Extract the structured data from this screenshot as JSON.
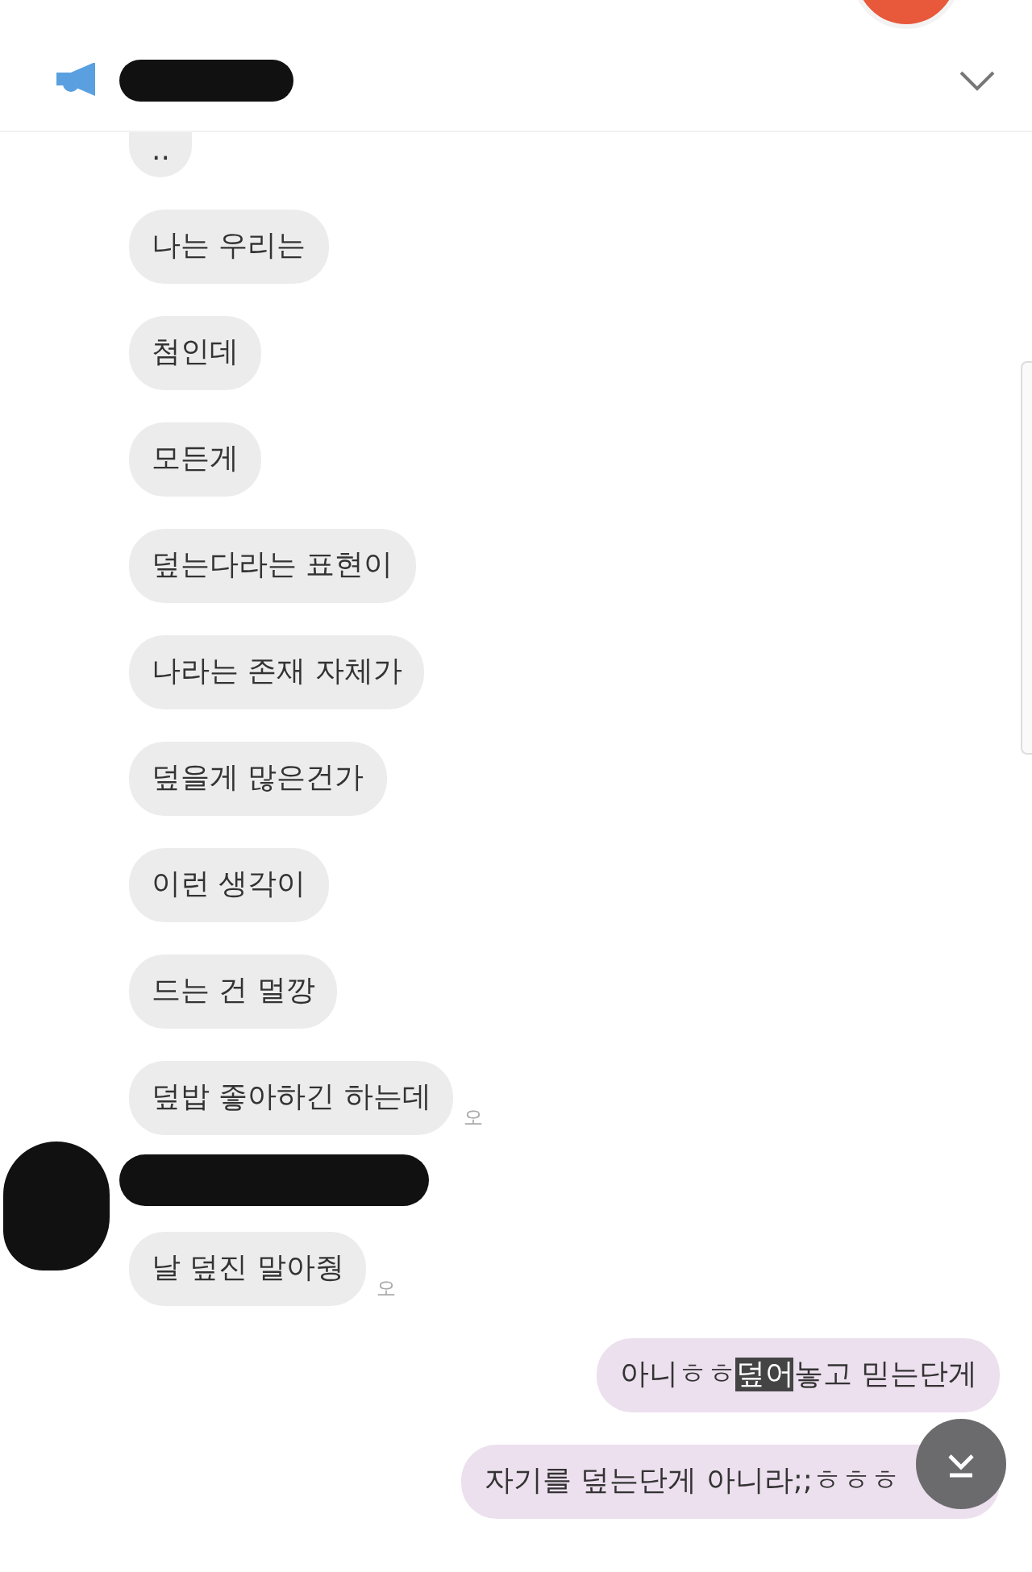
{
  "header": {
    "name_redacted": true
  },
  "messages": [
    {
      "kind": "received",
      "parts": [
        {
          "text": ".."
        }
      ],
      "cut": true
    },
    {
      "kind": "received",
      "parts": [
        {
          "text": "나는 우리는"
        }
      ]
    },
    {
      "kind": "received",
      "parts": [
        {
          "text": "첨인데"
        }
      ]
    },
    {
      "kind": "received",
      "parts": [
        {
          "text": "모든게"
        }
      ]
    },
    {
      "kind": "received",
      "parts": [
        {
          "text": "덮는다라는 표현이"
        }
      ]
    },
    {
      "kind": "received",
      "parts": [
        {
          "text": "나라는 존재 자체가"
        }
      ]
    },
    {
      "kind": "received",
      "parts": [
        {
          "text": "덮을게 많은건가"
        }
      ]
    },
    {
      "kind": "received",
      "parts": [
        {
          "text": "이런 생각이"
        }
      ]
    },
    {
      "kind": "received",
      "parts": [
        {
          "text": "드는 건 멀깡"
        }
      ]
    },
    {
      "kind": "received",
      "parts": [
        {
          "text": "덮밥 좋아하긴 하는데"
        }
      ],
      "time": "오"
    },
    {
      "kind": "received",
      "parts": [
        {
          "text": "날 덮진 말아줭"
        }
      ],
      "time": "오",
      "sender_redacted": true
    },
    {
      "kind": "sent",
      "parts": [
        {
          "text": "아니ㅎㅎ"
        },
        {
          "text": "덮어",
          "highlighted": true
        },
        {
          "text": "놓고 믿는단게"
        }
      ]
    },
    {
      "kind": "sent",
      "parts": [
        {
          "text": "자기를 덮는단게 아니라;;ㅎㅎㅎ"
        }
      ],
      "last": true
    }
  ]
}
